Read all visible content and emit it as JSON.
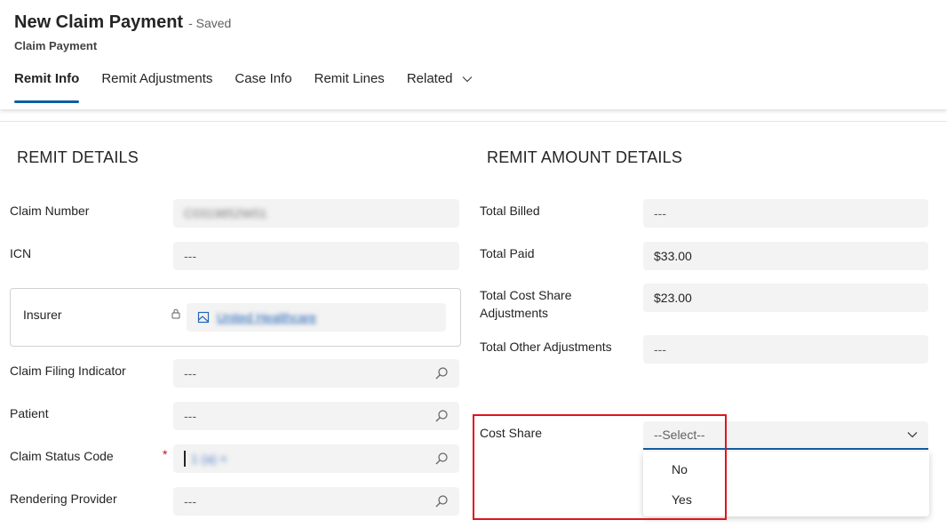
{
  "header": {
    "title": "New Claim Payment",
    "saved": "- Saved",
    "subtitle": "Claim Payment",
    "tabs": [
      "Remit Info",
      "Remit Adjustments",
      "Case Info",
      "Remit Lines",
      "Related"
    ]
  },
  "remit_details": {
    "title": "REMIT DETAILS",
    "claim_number": {
      "label": "Claim Number",
      "value": "C0319852W01"
    },
    "icn": {
      "label": "ICN",
      "value": "---"
    },
    "insurer": {
      "label": "Insurer",
      "value": "United Healthcare"
    },
    "claim_filing_indicator": {
      "label": "Claim Filing Indicator",
      "value": "---"
    },
    "patient": {
      "label": "Patient",
      "value": "---"
    },
    "claim_status_code": {
      "label": "Claim Status Code",
      "required_mark": "*",
      "value": "1 (a) ×"
    },
    "rendering_provider": {
      "label": "Rendering Provider",
      "value": "---"
    }
  },
  "remit_amount_details": {
    "title": "REMIT AMOUNT DETAILS",
    "total_billed": {
      "label": "Total Billed",
      "value": "---"
    },
    "total_paid": {
      "label": "Total Paid",
      "value": "$33.00"
    },
    "total_cost_share_line1": "Total Cost Share",
    "total_cost_share_line2": "Adjustments",
    "total_cost_share_value": "$23.00",
    "total_other": {
      "label": "Total Other Adjustments",
      "value": "---"
    },
    "cost_share": {
      "label": "Cost Share",
      "selected": "--Select--",
      "options": [
        "No",
        "Yes"
      ]
    }
  },
  "colors": {
    "accent": "#115ea3",
    "highlight": "#e0141e",
    "field_bg": "#f3f3f3"
  }
}
